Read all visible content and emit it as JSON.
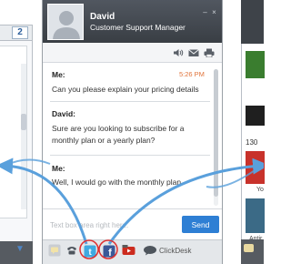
{
  "left_window": {
    "field_value": "2"
  },
  "right_window": {
    "count": "130",
    "name_1": "Yo",
    "name_2": "Antir"
  },
  "agent": {
    "name": "David",
    "role": "Customer Support Manager"
  },
  "messages": [
    {
      "sender": "Me:",
      "text": "Can you please explain your pricing details",
      "time": "5:26 PM"
    },
    {
      "sender": "David:",
      "text": "Sure are you looking to subscribe for a monthly plan or a yearly plan?"
    },
    {
      "sender": "Me:",
      "text": "Well, I would go with the monthly plan."
    }
  ],
  "compose": {
    "placeholder": "Text box area right here."
  },
  "send_label": "Send",
  "footer": {
    "brand": "ClickDesk",
    "icons": [
      "chat-icon",
      "phone-icon",
      "twitter-icon",
      "facebook-icon",
      "youtube-icon"
    ]
  },
  "toolbar_icons": [
    "speaker-icon",
    "email-icon",
    "print-icon"
  ],
  "colors": {
    "header_bg": "#444a51",
    "send_button": "#2e7fd4",
    "timestamp": "#e0733a",
    "arrow": "#5aa0dc",
    "highlight_ring": "#e03030",
    "twitter": "#3fa9e0",
    "facebook": "#3b5998",
    "youtube": "#cc2b1e"
  }
}
